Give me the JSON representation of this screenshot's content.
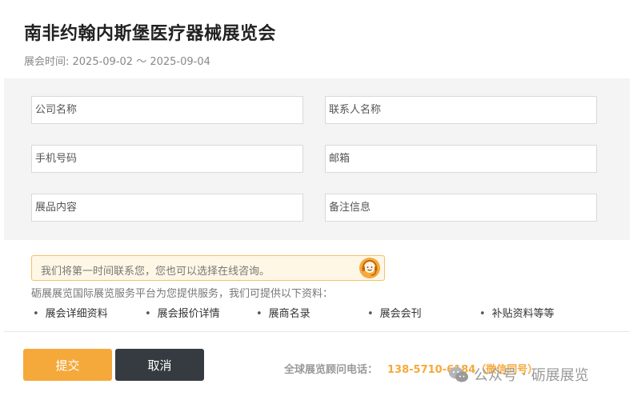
{
  "page": {
    "title": "南非约翰内斯堡医疗器械展览会",
    "dates": "展会时间: 2025-09-02 ～ 2025-09-04"
  },
  "form": {
    "company_name": {
      "placeholder": "公司名称",
      "value": ""
    },
    "contact_name": {
      "placeholder": "联系人名称",
      "value": ""
    },
    "phone": {
      "placeholder": "手机号码",
      "value": ""
    },
    "email": {
      "placeholder": "邮箱",
      "value": ""
    },
    "exhibit_content": {
      "placeholder": "展品内容",
      "value": ""
    },
    "remarks": {
      "placeholder": "备注信息",
      "value": ""
    }
  },
  "notice": {
    "text": "我们将第一时间联系您，您也可以选择在线咨询。",
    "icon": "customer-service-icon"
  },
  "intro": "砺展展览国际展览服务平台为您提供服务，我们可提供以下资料：",
  "resources": [
    "展会详细资料",
    "展会报价详情",
    "展商名录",
    "展会会刊",
    "补贴资料等等"
  ],
  "actions": {
    "submit_label": "提交",
    "cancel_label": "取消"
  },
  "contact": {
    "label": "全球展览顾问电话：",
    "number": "138-5710-6184（微信同号）"
  },
  "watermark": {
    "icon": "wechat-icon",
    "source": "公众号",
    "separator": "·",
    "name": "砺展展览"
  },
  "colors": {
    "accent": "#f5a93b",
    "dark_button": "#353b40",
    "panel": "#f4f4f4",
    "notice_border": "#f5c16a",
    "notice_bg": "#fff7e6"
  }
}
